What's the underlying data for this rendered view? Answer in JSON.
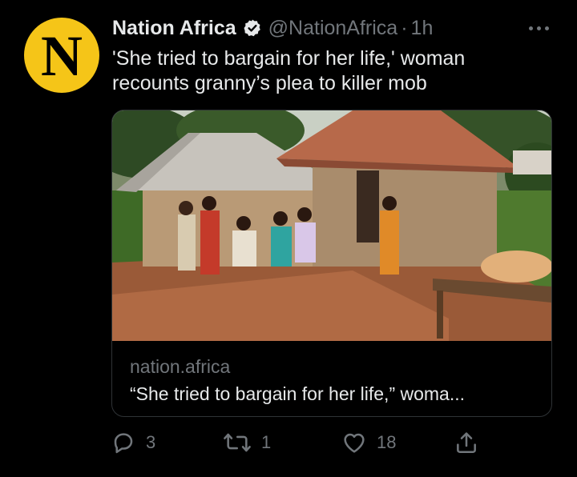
{
  "avatar": {
    "letter": "N",
    "color": "#f5c518"
  },
  "header": {
    "name": "Nation Africa",
    "handle": "@NationAfrica",
    "separator": "·",
    "time": "1h",
    "verified_icon": "verified-badge-icon",
    "more_icon": "more-horizontal-icon"
  },
  "tweet": {
    "text": "'She tried to bargain for her life,' woman recounts granny’s plea to killer mob"
  },
  "card": {
    "domain": "nation.africa",
    "title": "“She tried to bargain for her life,” woma..."
  },
  "actions": {
    "reply": {
      "icon": "reply-icon",
      "count": "3"
    },
    "retweet": {
      "icon": "retweet-icon",
      "count": "1"
    },
    "like": {
      "icon": "heart-icon",
      "count": "18"
    },
    "share": {
      "icon": "share-icon"
    }
  },
  "colors": {
    "background": "#000000",
    "text_primary": "#e7e9ea",
    "text_secondary": "#71767b",
    "border": "#2f3336"
  }
}
